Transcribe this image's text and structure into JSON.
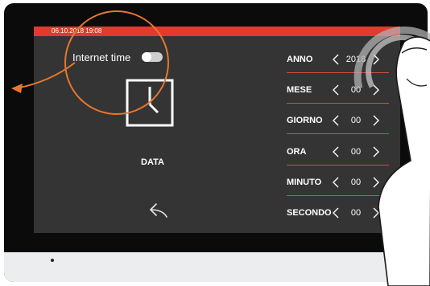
{
  "status_bar": {
    "datetime": "06.10.2018 19:08"
  },
  "internet_time": {
    "label": "Internet time",
    "enabled": false
  },
  "date_section": {
    "label": "DATA"
  },
  "fields": [
    {
      "label": "ANNO",
      "value": "2018"
    },
    {
      "label": "MESE",
      "value": "00"
    },
    {
      "label": "GIORNO",
      "value": "00"
    },
    {
      "label": "ORA",
      "value": "00"
    },
    {
      "label": "MINUTO",
      "value": "00"
    },
    {
      "label": "SECONDO",
      "value": "00"
    }
  ],
  "icons": {
    "clock": "clock-icon",
    "back": "back-arrow-icon",
    "left": "chevron-left-icon",
    "right": "chevron-right-icon",
    "callout": "callout-arrow-icon",
    "hand": "tapping-hand-icon"
  },
  "colors": {
    "accent": "#e13a2e",
    "screen": "#343434",
    "annotation": "#e8772e"
  }
}
